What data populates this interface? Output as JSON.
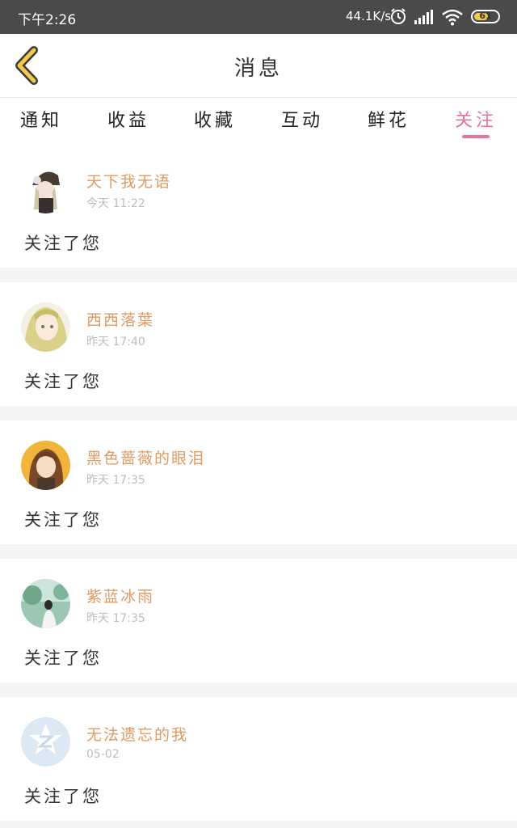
{
  "status_bar": {
    "time": "下午2:26",
    "speed": "44.1K/s",
    "battery": "61",
    "battery_fraction": 0.61
  },
  "header": {
    "title": "消息",
    "back_icon": "chevron-left-icon"
  },
  "tabs": [
    {
      "label": "通知",
      "active": false
    },
    {
      "label": "收益",
      "active": false
    },
    {
      "label": "收藏",
      "active": false
    },
    {
      "label": "互动",
      "active": false
    },
    {
      "label": "鲜花",
      "active": false
    },
    {
      "label": "关注",
      "active": true
    }
  ],
  "colors": {
    "accent": "#e8739d",
    "username": "#e09a62",
    "timestamp": "#bdbdbd"
  },
  "messages": [
    {
      "username": "天下我无语",
      "time": "今天 11:22",
      "text": "关注了您",
      "avatar": "anime-girl-avatar"
    },
    {
      "username": "西西落葉",
      "time": "昨天 17:40",
      "text": "关注了您",
      "avatar": "blonde-girl-avatar"
    },
    {
      "username": "黑色蔷薇的眼泪",
      "time": "昨天 17:35",
      "text": "关注了您",
      "avatar": "brown-hair-girl-avatar"
    },
    {
      "username": "紫蓝冰雨",
      "time": "昨天 17:35",
      "text": "关注了您",
      "avatar": "nature-photo-avatar"
    },
    {
      "username": "无法遗忘的我",
      "time": "05-02",
      "text": "关注了您",
      "avatar": "default-avatar"
    }
  ]
}
